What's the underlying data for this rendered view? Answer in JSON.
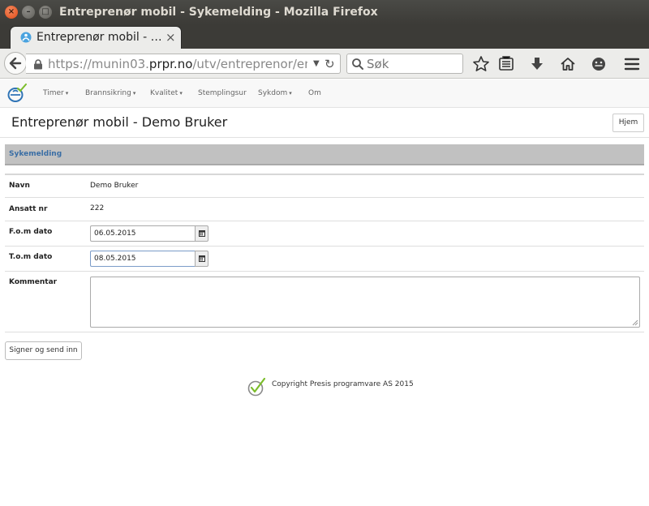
{
  "window": {
    "title": "Entreprenør mobil - Sykemelding - Mozilla Firefox",
    "controls": {
      "close": "×",
      "minimize": "–",
      "maximize": "□"
    }
  },
  "browser": {
    "tab_title": "Entreprenør mobil - …",
    "tab_close": "×",
    "url_prefix": "https://munin03.",
    "url_domain": "prpr.no",
    "url_suffix": "/utv/entreprenor/entrep",
    "search_placeholder": "Søk",
    "icons": [
      "back-arrow-icon",
      "lock-icon",
      "reload-icon",
      "search-icon",
      "bookmark-star-icon",
      "reading-list-icon",
      "download-icon",
      "home-icon",
      "emoji-icon",
      "hamburger-menu-icon"
    ]
  },
  "app": {
    "menu": [
      {
        "label": "Timer",
        "caret": "▾"
      },
      {
        "label": "Brannsikring",
        "caret": "▾"
      },
      {
        "label": "Kvalitet",
        "caret": "▾"
      },
      {
        "label": "Stemplingsur",
        "caret": ""
      },
      {
        "label": "Sykdom",
        "caret": "▾"
      },
      {
        "label": "Om",
        "caret": ""
      }
    ],
    "page_title": "Entreprenør mobil - Demo Bruker",
    "home_button": "Hjem",
    "section_title": "Sykemelding",
    "accent_color": "#3a6ea5"
  },
  "form": {
    "name_label": "Navn",
    "name_value": "Demo Bruker",
    "employee_label": "Ansatt nr",
    "employee_value": "222",
    "from_label": "F.o.m dato",
    "from_value": "06.05.2015",
    "to_label": "T.o.m dato",
    "to_value": "08.05.2015",
    "comment_label": "Kommentar",
    "comment_value": "",
    "submit_label": "Signer og send inn"
  },
  "footer": {
    "copyright": "Copyright Presis programvare AS 2015"
  }
}
